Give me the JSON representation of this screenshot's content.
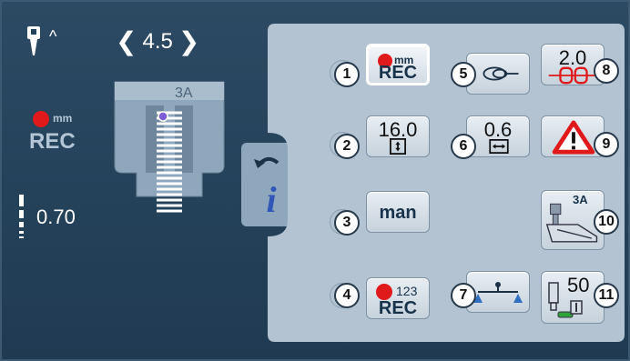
{
  "status": {
    "needle_position_caret": "^",
    "stitch_width": "4.5",
    "rec_unit": "mm",
    "rec_label": "REC",
    "tension_value": "0.70",
    "foot_label": "3A"
  },
  "buttons": [
    {
      "number": "1",
      "unit": "mm",
      "label": "REC",
      "icon": "rec-pattern-length-icon",
      "active": true
    },
    {
      "number": "2",
      "value": "16.0",
      "icon": "pattern-length-icon"
    },
    {
      "number": "3",
      "label": "man",
      "icon": "manual-buttonhole-icon"
    },
    {
      "number": "4",
      "unit": "123",
      "label": "REC",
      "icon": "rec-stitch-count-icon"
    },
    {
      "number": "5",
      "icon": "buttonhole-loop-icon"
    },
    {
      "number": "6",
      "value": "0.6",
      "icon": "slit-width-icon"
    },
    {
      "number": "7",
      "icon": "balance-icon"
    },
    {
      "number": "8",
      "value": "2.0",
      "icon": "bartack-width-icon"
    },
    {
      "number": "9",
      "icon": "warning-icon"
    },
    {
      "number": "10",
      "label": "3A",
      "icon": "presser-foot-icon"
    },
    {
      "number": "11",
      "value": "50",
      "icon": "foot-pressure-icon"
    }
  ],
  "colors": {
    "background": "#24415a",
    "panel": "#b3c3d1",
    "rec_dot": "#e0191b",
    "warning": "#e0191b"
  }
}
